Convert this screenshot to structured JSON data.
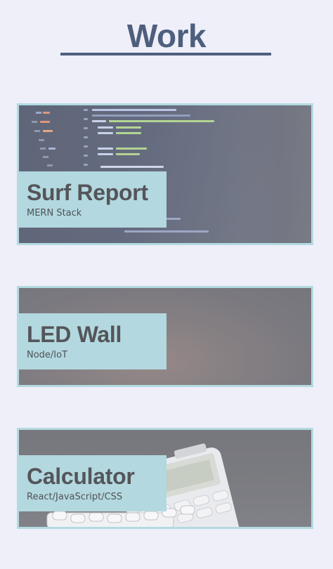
{
  "header": {
    "title": "Work"
  },
  "projects": [
    {
      "title": "Surf Report",
      "tech": "MERN Stack",
      "image_icon": "code-editor-photo"
    },
    {
      "title": "LED Wall",
      "tech": "Node/IoT",
      "image_icon": "led-wall-photo"
    },
    {
      "title": "Calculator",
      "tech": "React/JavaScript/CSS",
      "image_icon": "calculator-photo"
    }
  ],
  "colors": {
    "background": "#efeff9",
    "title": "#4e5f7e",
    "caption_background": "#b3d8df",
    "card_border": "#b3dbe1",
    "caption_text": "#54555a"
  }
}
